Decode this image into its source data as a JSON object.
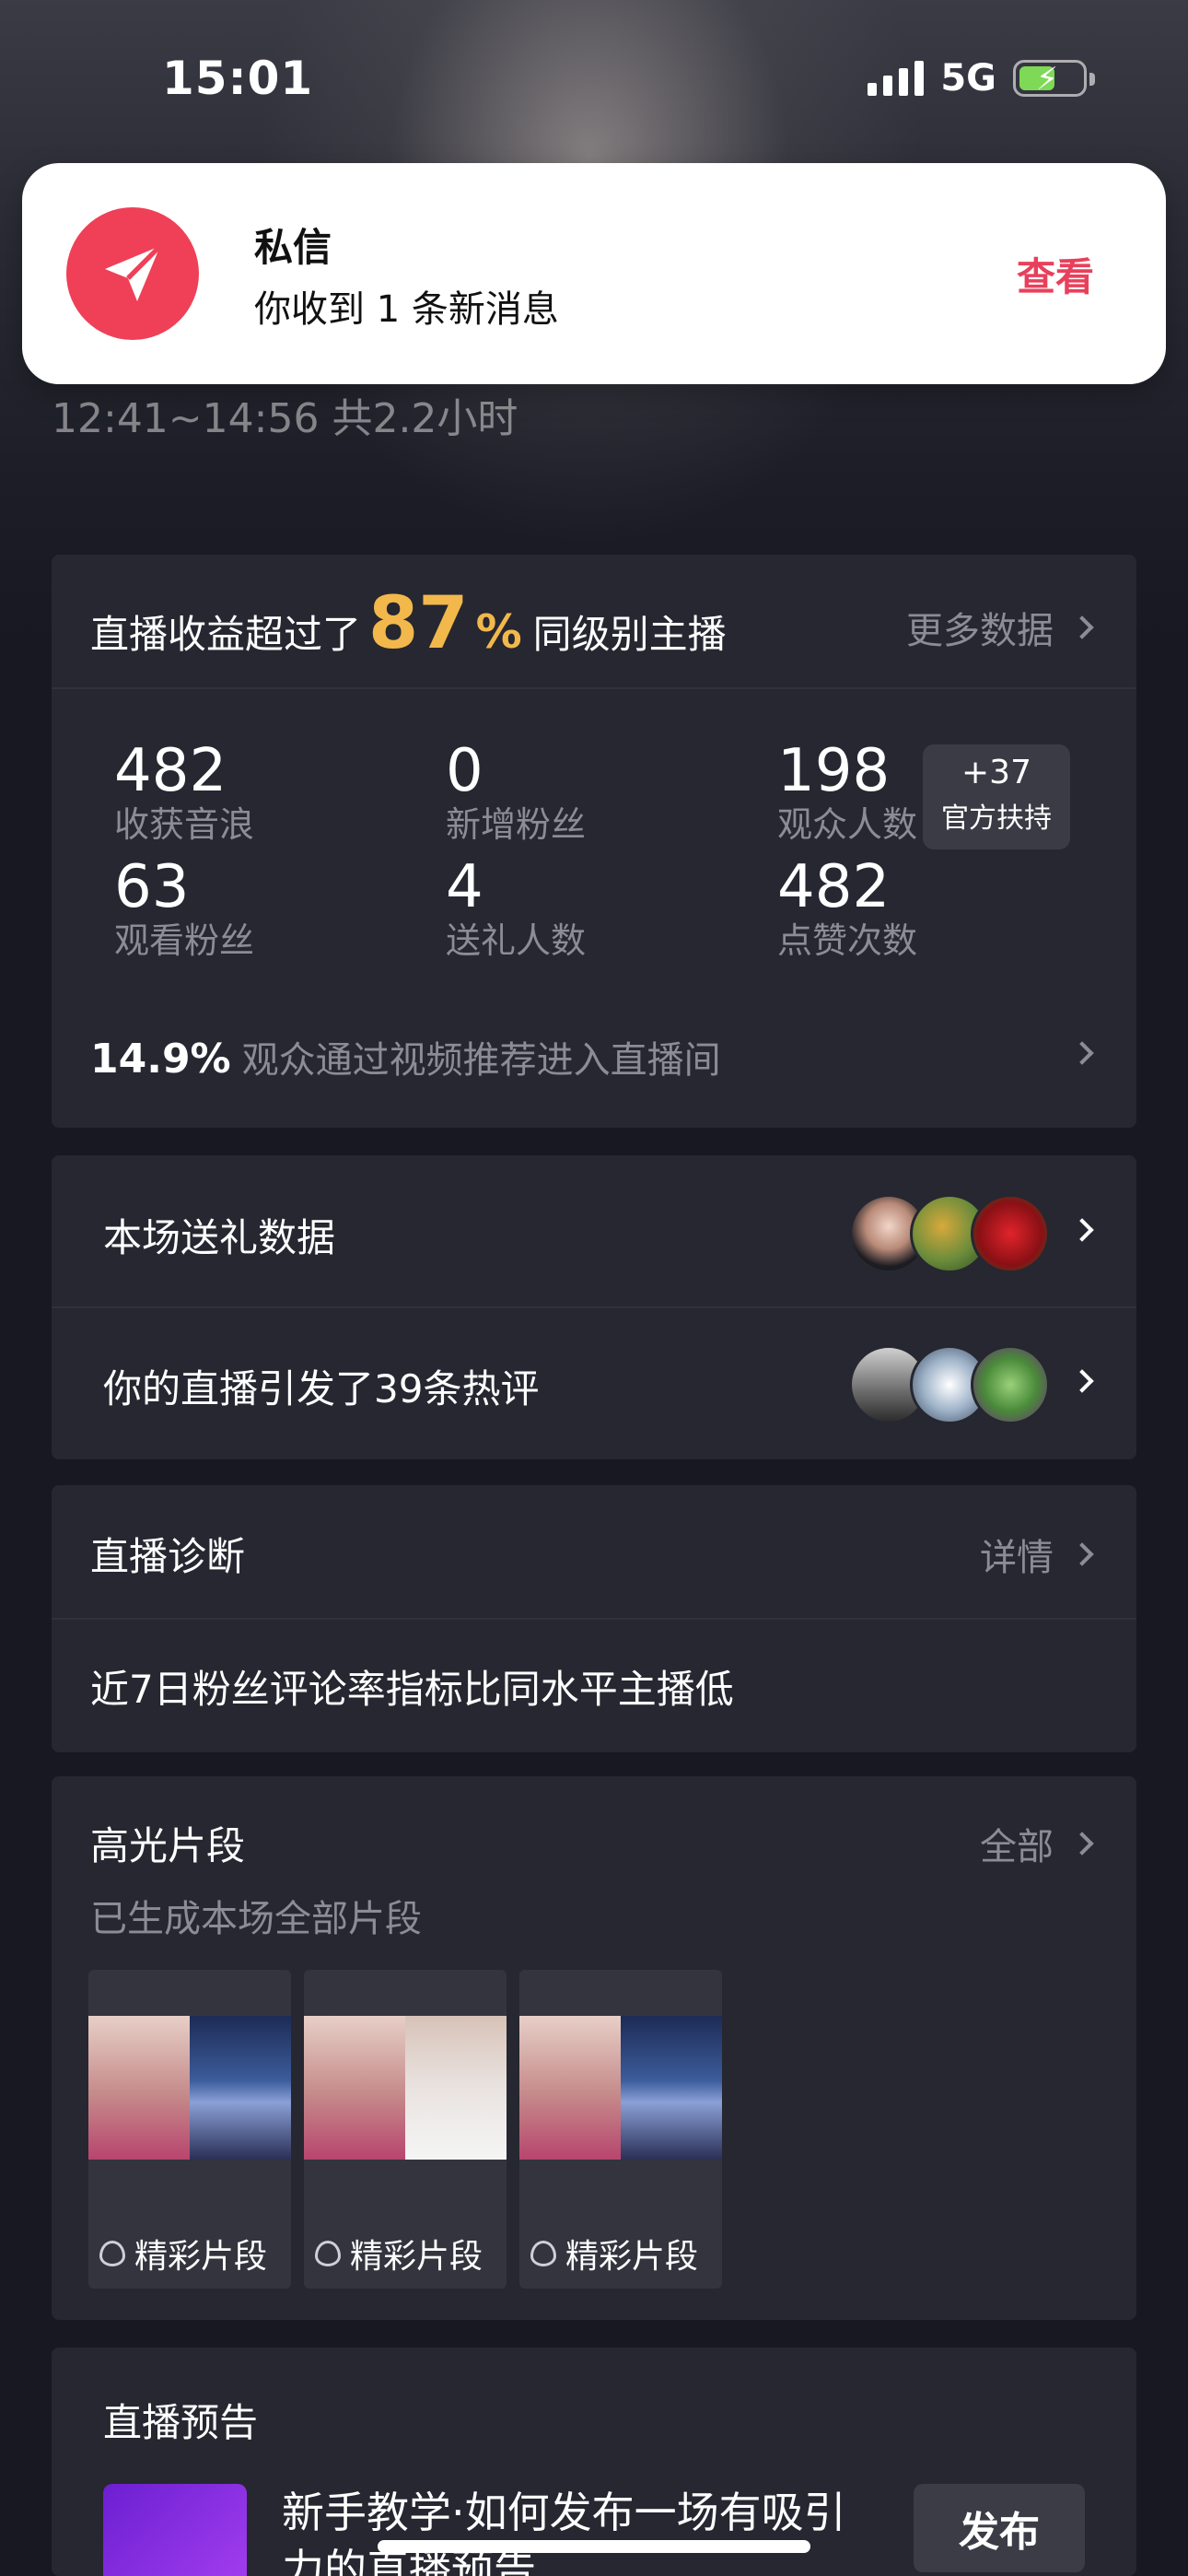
{
  "status_bar": {
    "time": "15:01",
    "network": "5G",
    "battery_color": "#7ed957"
  },
  "notification": {
    "title": "私信",
    "body": "你收到 1 条新消息",
    "action": "查看",
    "icon": "send-icon",
    "accent": "#ef4058"
  },
  "session": {
    "time_range": "12:41~14:56 共2.2小时"
  },
  "summary": {
    "prefix": "直播收益超过了",
    "percent": "87",
    "percent_sign": "%",
    "suffix": "同级别主播",
    "more": "更多数据",
    "highlight_color": "#f2b84b",
    "stats": [
      {
        "value": "482",
        "label": "收获音浪"
      },
      {
        "value": "0",
        "label": "新增粉丝"
      },
      {
        "value": "198",
        "label": "观众人数"
      },
      {
        "value": "63",
        "label": "观看粉丝"
      },
      {
        "value": "4",
        "label": "送礼人数"
      },
      {
        "value": "482",
        "label": "点赞次数"
      }
    ],
    "badge": {
      "value": "+37",
      "label": "官方扶持"
    },
    "footer_percent": "14.9%",
    "footer_text": "观众通过视频推荐进入直播间"
  },
  "rows": [
    {
      "label": "本场送礼数据"
    },
    {
      "label": "你的直播引发了39条热评"
    }
  ],
  "diagnosis": {
    "title": "直播诊断",
    "more": "详情",
    "text": "近7日粉丝评论率指标比同水平主播低"
  },
  "highlights": {
    "title": "高光片段",
    "more": "全部",
    "subtitle": "已生成本场全部片段",
    "clips": [
      {
        "caption": "精彩片段"
      },
      {
        "caption": "精彩片段"
      },
      {
        "caption": "精彩片段"
      }
    ]
  },
  "preview": {
    "title": "直播预告",
    "text": "新手教学·如何发布一场有吸引力的直播预告",
    "button": "发布"
  }
}
